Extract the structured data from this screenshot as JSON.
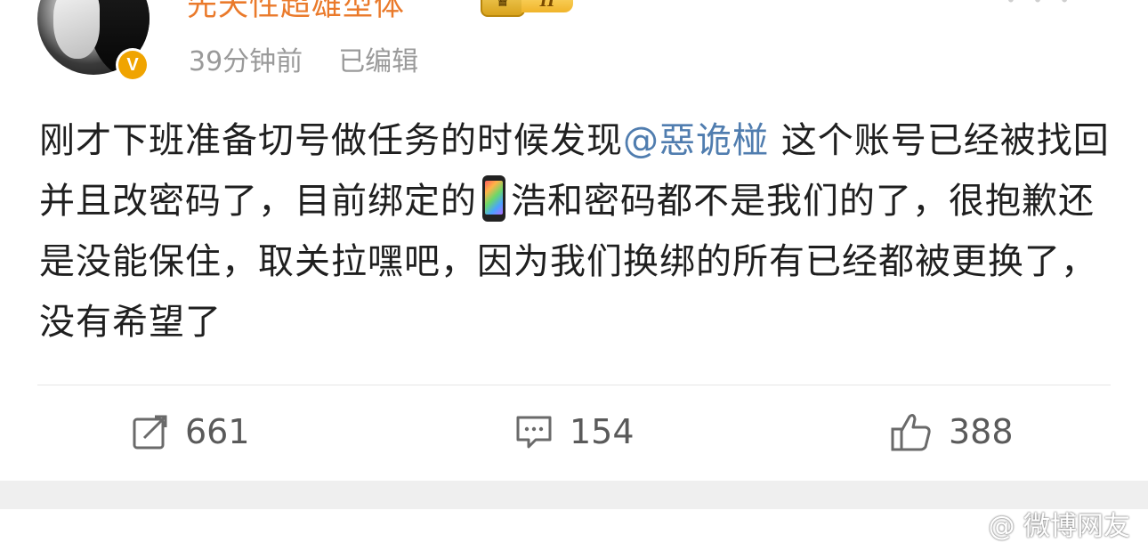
{
  "post": {
    "author": "先天性超雄型体",
    "vip_level": "II",
    "verified_mark": "V",
    "time_ago": "39分钟前",
    "edited_label": "已编辑",
    "text_part1": "刚才下班准备切号做任务的时候发现",
    "mention": "@惡诡椪",
    "text_part2": " 这个账号已经被找回并且改密码了，目前绑定的",
    "phone_emoji_name": "mobile-phone",
    "text_part3": "浩和密码都不是我们的了，很抱歉还是没能保住，取关拉嘿吧，因为我们换绑的所有已经都被更换了，没有希望了"
  },
  "actions": {
    "repost_count": "661",
    "comment_count": "154",
    "like_count": "388"
  },
  "watermark": "@ 微博网友"
}
